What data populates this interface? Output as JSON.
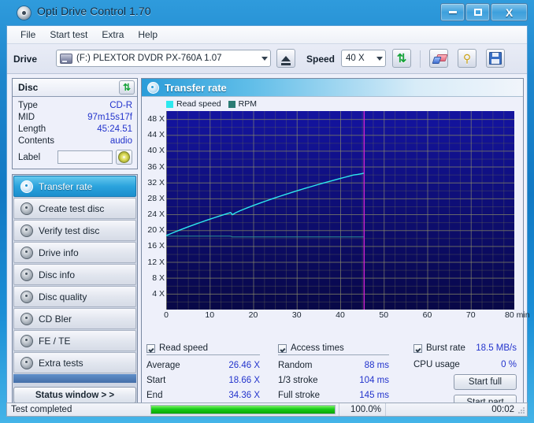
{
  "window": {
    "title": "Opti Drive Control 1.70",
    "icon": "disc-icon",
    "controls": {
      "minimize": "–",
      "maximize": "□",
      "close": "X"
    }
  },
  "menu": {
    "items": [
      "File",
      "Start test",
      "Extra",
      "Help"
    ]
  },
  "toolbar": {
    "drive_label": "Drive",
    "drive_value": "(F:)  PLEXTOR DVDR  PX-760A 1.07",
    "eject_icon": "eject-icon",
    "speed_label": "Speed",
    "speed_value": "40 X",
    "refresh_icon": "refresh-icon",
    "erase_icon": "erase-icon",
    "settings_icon": "key-icon",
    "save_icon": "save-icon"
  },
  "disc": {
    "title": "Disc",
    "refresh_icon": "refresh-icon",
    "rows": [
      {
        "key": "Type",
        "value": "CD-R"
      },
      {
        "key": "MID",
        "value": "97m15s17f"
      },
      {
        "key": "Length",
        "value": "45:24.51"
      },
      {
        "key": "Contents",
        "value": "audio"
      }
    ],
    "label_key": "Label",
    "label_value": "",
    "label_button_icon": "cd-icon"
  },
  "nav": {
    "items": [
      {
        "label": "Transfer rate",
        "active": true
      },
      {
        "label": "Create test disc",
        "active": false
      },
      {
        "label": "Verify test disc",
        "active": false
      },
      {
        "label": "Drive info",
        "active": false
      },
      {
        "label": "Disc info",
        "active": false
      },
      {
        "label": "Disc quality",
        "active": false
      },
      {
        "label": "CD Bler",
        "active": false
      },
      {
        "label": "FE / TE",
        "active": false
      },
      {
        "label": "Extra tests",
        "active": false
      }
    ],
    "status_window_label": "Status window > >"
  },
  "chart_panel": {
    "title": "Transfer rate",
    "icon": "disc-icon"
  },
  "chart_data": {
    "type": "line",
    "title": "Transfer rate",
    "xlabel": "min",
    "ylabel": "X",
    "xlim": [
      0,
      80
    ],
    "ylim": [
      0,
      50
    ],
    "xticks": [
      0,
      10,
      20,
      30,
      40,
      50,
      60,
      70,
      80
    ],
    "xtick_labels": [
      "0",
      "10",
      "20",
      "30",
      "40",
      "50",
      "60",
      "70",
      "80 min"
    ],
    "yticks": [
      4,
      8,
      12,
      16,
      20,
      24,
      28,
      32,
      36,
      40,
      44,
      48
    ],
    "ytick_labels": [
      "4 X",
      "8 X",
      "12 X",
      "16 X",
      "20 X",
      "24 X",
      "28 X",
      "32 X",
      "36 X",
      "40 X",
      "44 X",
      "48 X"
    ],
    "grid": true,
    "plot_bg": "#0a0a48",
    "legend": [
      {
        "name": "Read speed",
        "color": "#2de8ee"
      },
      {
        "name": "RPM",
        "color": "#2a7b74"
      }
    ],
    "legend_position": "top-left",
    "marker_line": {
      "x": 45.4,
      "color": "#cc22cc"
    },
    "series": [
      {
        "name": "Read speed",
        "color": "#2de8ee",
        "x": [
          0,
          1,
          2,
          3,
          4,
          5,
          6,
          7,
          8,
          9,
          10,
          11,
          12,
          13,
          14,
          14.8,
          15.2,
          16,
          17,
          18,
          19,
          20,
          21,
          22,
          23,
          24,
          25,
          26,
          27,
          28,
          29,
          30,
          31,
          32,
          33,
          34,
          35,
          36,
          37,
          38,
          39,
          40,
          41,
          42,
          43,
          44,
          45,
          45.4
        ],
        "y": [
          18.66,
          19.1,
          19.55,
          19.98,
          20.4,
          20.82,
          21.22,
          21.62,
          22.0,
          22.38,
          22.76,
          23.12,
          23.48,
          23.83,
          24.17,
          24.44,
          23.9,
          24.4,
          24.9,
          25.35,
          25.78,
          26.2,
          26.6,
          27.0,
          27.38,
          27.76,
          28.13,
          28.5,
          28.86,
          29.21,
          29.55,
          29.9,
          30.23,
          30.56,
          30.88,
          31.2,
          31.52,
          31.83,
          32.13,
          32.43,
          32.73,
          33.02,
          33.31,
          33.6,
          33.88,
          34.05,
          34.25,
          34.36
        ]
      },
      {
        "name": "RPM",
        "color": "#2a8f94",
        "x": [
          0,
          14.8,
          15.2,
          45.4
        ],
        "y": [
          18.5,
          18.5,
          18.3,
          18.3
        ]
      }
    ]
  },
  "stats": {
    "read_speed": {
      "header": "Read speed",
      "checked": true,
      "rows": [
        {
          "key": "Average",
          "value": "26.46 X"
        },
        {
          "key": "Start",
          "value": "18.66 X"
        },
        {
          "key": "End",
          "value": "34.36 X"
        }
      ]
    },
    "access_times": {
      "header": "Access times",
      "checked": true,
      "rows": [
        {
          "key": "Random",
          "value": "88 ms"
        },
        {
          "key": "1/3 stroke",
          "value": "104 ms"
        },
        {
          "key": "Full stroke",
          "value": "145 ms"
        }
      ]
    },
    "burst": {
      "header": "Burst rate",
      "checked": true,
      "header_value": "18.5 MB/s",
      "cpu_key": "CPU usage",
      "cpu_value": "0 %",
      "start_full": "Start full",
      "start_part": "Start part"
    }
  },
  "statusbar": {
    "message": "Test completed",
    "progress_text": "100.0%",
    "progress_percent": 100,
    "elapsed": "00:02"
  }
}
